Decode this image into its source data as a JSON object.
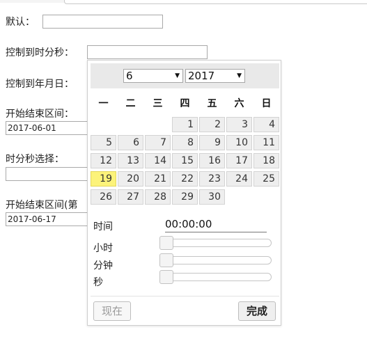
{
  "form": {
    "default_label": "默认：",
    "hms_label": "控制到时分秒：",
    "ymd_label": "控制到年月日：",
    "range_label": "开始结束区间：",
    "range_value": "2017-06-01",
    "time_label": "时分秒选择：",
    "range2_label": "开始结束区间(第",
    "range2_value": "2017-06-17"
  },
  "picker": {
    "month": "6",
    "year": "2017",
    "weekdays": [
      "一",
      "二",
      "三",
      "四",
      "五",
      "六",
      "日"
    ],
    "days": [
      "1",
      "2",
      "3",
      "4",
      "5",
      "6",
      "7",
      "8",
      "9",
      "10",
      "11",
      "12",
      "13",
      "14",
      "15",
      "16",
      "17",
      "18",
      "19",
      "20",
      "21",
      "22",
      "23",
      "24",
      "25",
      "26",
      "27",
      "28",
      "29",
      "30"
    ],
    "selected_day": "19",
    "time_label": "时间",
    "time_value": "00:00:00",
    "hour_label": "小时",
    "minute_label": "分钟",
    "second_label": "秒",
    "hour": 0,
    "minute": 0,
    "second": 0,
    "now_button": "现在",
    "done_button": "完成"
  },
  "colors": {
    "selected_day_bg": "#fcf37a",
    "day_bg": "#eeeeee",
    "header_bg": "#e9e9e9"
  }
}
